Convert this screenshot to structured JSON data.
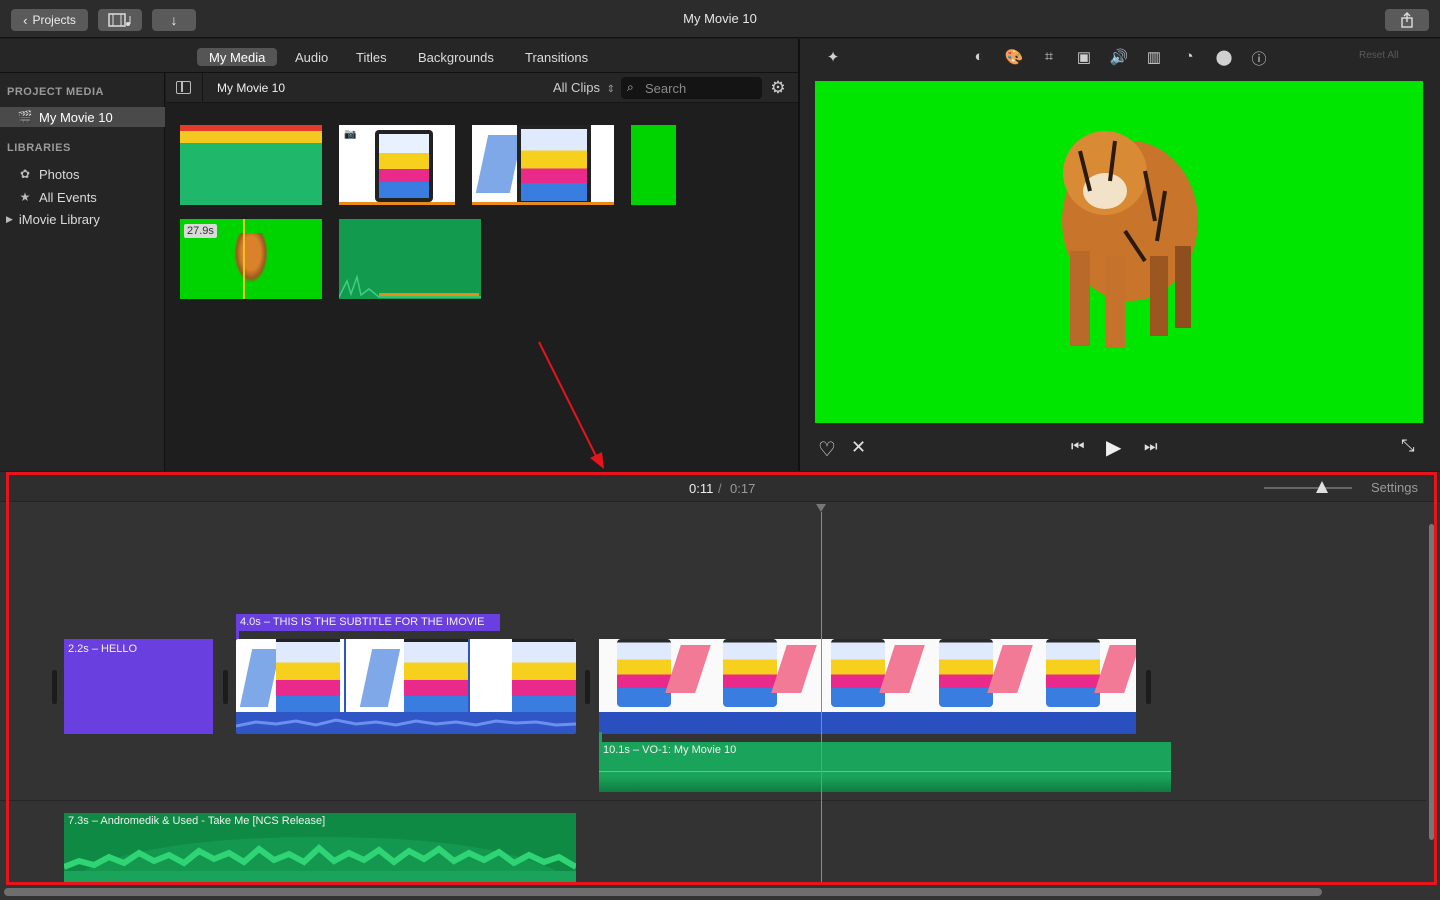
{
  "window": {
    "title": "My Movie 10",
    "projects_label": "Projects"
  },
  "media_tabs": [
    {
      "label": "My Media",
      "active": true
    },
    {
      "label": "Audio",
      "active": false
    },
    {
      "label": "Titles",
      "active": false
    },
    {
      "label": "Backgrounds",
      "active": false
    },
    {
      "label": "Transitions",
      "active": false
    }
  ],
  "sidebar": {
    "project_media_heading": "PROJECT MEDIA",
    "project_item": "My Movie 10",
    "libraries_heading": "LIBRARIES",
    "libraries": [
      {
        "label": "Photos",
        "icon": "flower-icon"
      },
      {
        "label": "All Events",
        "icon": "star-icon"
      },
      {
        "label": "iMovie Library",
        "icon": "disclosure-triangle-icon"
      }
    ]
  },
  "browser": {
    "title": "My Movie 10",
    "filter_label": "All Clips",
    "search_placeholder": "Search",
    "clip_duration_badge": "27.9s"
  },
  "viewer": {
    "reset_label": "Reset All"
  },
  "timeline": {
    "current_time": "0:11",
    "separator": "/",
    "total_time": "0:17",
    "settings_label": "Settings",
    "zoom_level": 0.68,
    "clips": {
      "title_hello": "2.2s – HELLO",
      "subtitle": "4.0s – THIS IS THE SUBTITLE FOR THE IMOVIE",
      "voiceover": "10.1s – VO-1: My Movie 10",
      "music": "7.3s – Andromedik & Used - Take Me [NCS Release]"
    }
  },
  "colors": {
    "title_purple": "#6a3fe0",
    "audio_green": "#1aa35a",
    "green_screen": "#00e600",
    "highlight_red": "#e8141b",
    "waveform_blue": "#2f56c4"
  }
}
